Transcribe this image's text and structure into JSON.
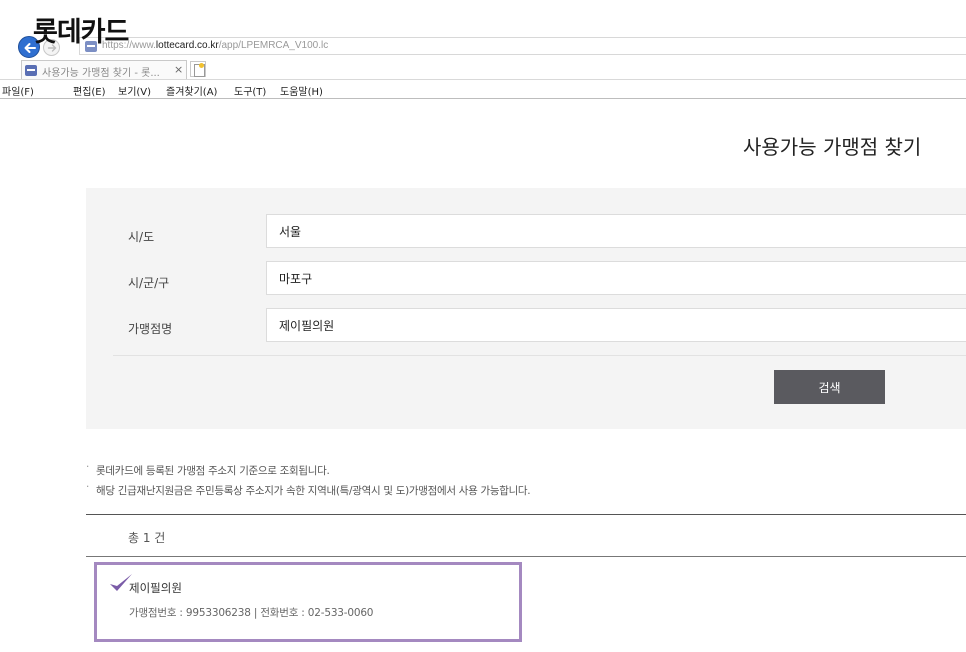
{
  "overlay_title": "롯데카드",
  "browser": {
    "url_prefix": "https://www.",
    "url_host": "lottecard.co.kr",
    "url_path": "/app/LPEMRCA_V100.lc",
    "tab_title": "사용가능 가맹점 찾기 - 롯...",
    "tab_close": "×",
    "menu": [
      "파일(F)",
      "편집(E)",
      "보기(V)",
      "즐겨찾기(A)",
      "도구(T)",
      "도움말(H)"
    ]
  },
  "page": {
    "title": "사용가능 가맹점 찾기"
  },
  "form": {
    "fields": [
      {
        "label": "시/도",
        "value": "서울"
      },
      {
        "label": "시/군/구",
        "value": "마포구"
      },
      {
        "label": "가맹점명",
        "value": "제이필의원"
      }
    ],
    "search_label": "검색"
  },
  "notes": [
    "롯데카드에 등록된 가맹점 주소지 기준으로 조회됩니다.",
    "해당 긴급재난지원금은 주민등록상 주소지가 속한 지역내(특/광역시 및 도)가맹점에서 사용 가능합니다."
  ],
  "note_bullet": "·",
  "results": {
    "count_text": "총 1 건",
    "items": [
      {
        "name": "제이필의원",
        "info": "가맹점번호 : 9953306238 | 전화번호 : 02-533-0060"
      }
    ]
  },
  "colors": {
    "search_button": "#5a5a5f",
    "highlight_border": "#a489c0",
    "checkmark": "#7b5ca8",
    "panel_bg": "#f4f4f4"
  },
  "icons": {
    "back": "back-arrow-icon",
    "forward": "forward-arrow-icon",
    "favicon": "site-favicon-icon",
    "new_tab": "new-tab-icon",
    "check": "checkmark-icon"
  }
}
